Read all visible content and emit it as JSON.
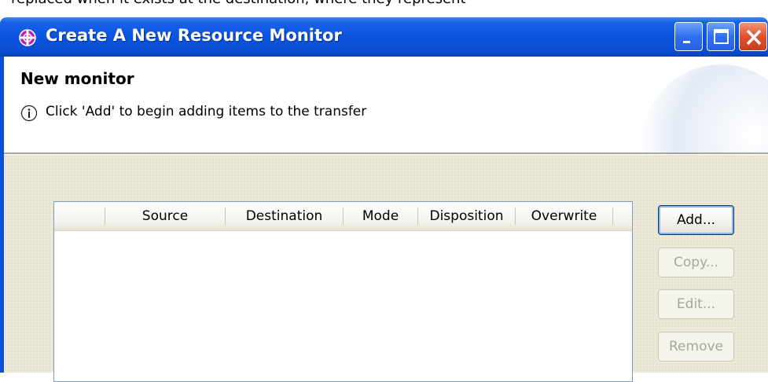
{
  "top_text": "replaced when it exists at the destination, where they represent",
  "window": {
    "title": "Create A New Resource Monitor",
    "controls": [
      "minimize",
      "maximize",
      "close"
    ]
  },
  "header": {
    "title": "New monitor",
    "message": "Click 'Add' to begin adding items to the transfer"
  },
  "table": {
    "columns": [
      "",
      "Source",
      "Destination",
      "Mode",
      "Disposition",
      "Overwrite"
    ]
  },
  "buttons": {
    "add": "Add...",
    "copy": "Copy...",
    "edit": "Edit...",
    "remove": "Remove"
  },
  "colors": {
    "titlebar": "#0a50d6",
    "dialog_bg": "#ece9d8",
    "close_button": "#e2502c"
  },
  "icons": [
    "app-icon",
    "info-icon",
    "minimize-icon",
    "maximize-icon",
    "close-icon"
  ]
}
